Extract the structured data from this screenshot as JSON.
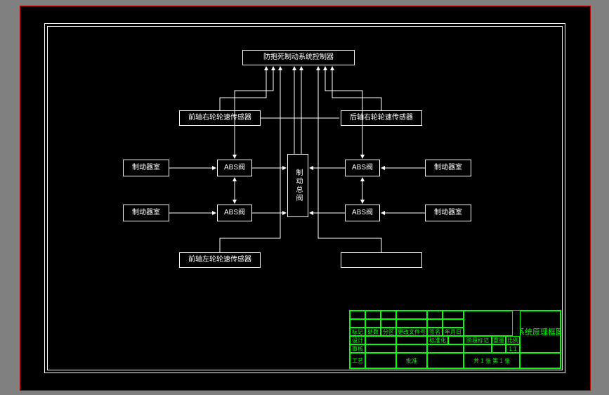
{
  "diagram": {
    "top_controller": "防抱死制动系统控制器",
    "sensor_fr": "前轴右轮轮速传感器",
    "sensor_rr": "后轴右轮轮速传感器",
    "sensor_fl": "前轴左轮轮速传感器",
    "sensor_rl": "",
    "brake_chamber": "制动器室",
    "abs_valve": "ABS阀",
    "center_valve": "制动总阀"
  },
  "titleblock": {
    "title": "系统原理框图",
    "row_headers": [
      "标记",
      "处数",
      "分区",
      "更改文件号",
      "签名",
      "年月日"
    ],
    "row2": [
      "设计",
      "",
      "",
      "",
      "标准化",
      ""
    ],
    "row3": [
      "审核",
      "",
      "",
      "",
      ""
    ],
    "row4": [
      "工艺",
      "",
      "",
      "批准",
      ""
    ],
    "stage": "阶段标记",
    "weight": "重量",
    "scale": "比例",
    "scale_val": "1:1",
    "sheet": "共 1 张  第 1 张"
  }
}
